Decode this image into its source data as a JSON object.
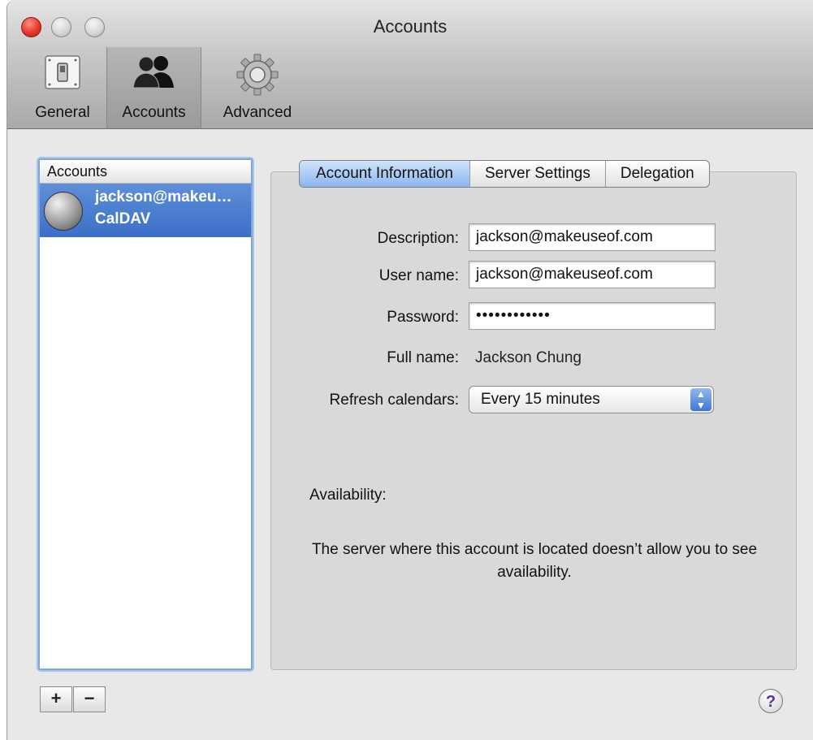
{
  "window": {
    "title": "Accounts"
  },
  "toolbar": {
    "items": [
      {
        "label": "General",
        "icon": "switch-icon",
        "active": false
      },
      {
        "label": "Accounts",
        "icon": "people-icon",
        "active": true
      },
      {
        "label": "Advanced",
        "icon": "gear-icon",
        "active": false
      }
    ]
  },
  "sidebar": {
    "header": "Accounts",
    "accounts": [
      {
        "name": "jackson@makeu…",
        "type": "CalDAV",
        "selected": true
      }
    ],
    "add_label": "+",
    "remove_label": "−"
  },
  "tabs": [
    "Account Information",
    "Server Settings",
    "Delegation"
  ],
  "form": {
    "description_label": "Description:",
    "description_value": "jackson@makeuseof.com",
    "username_label": "User name:",
    "username_value": "jackson@makeuseof.com",
    "password_label": "Password:",
    "password_value": "••••••••••••",
    "fullname_label": "Full name:",
    "fullname_value": "Jackson Chung",
    "refresh_label": "Refresh calendars:",
    "refresh_value": "Every 15 minutes",
    "stepper_glyph": "▲▼"
  },
  "availability": {
    "label": "Availability:",
    "message": "The server where this account is located doesn’t allow you to see availability."
  },
  "help": {
    "label": "?"
  },
  "colors": {
    "selection": "#3c6fc8",
    "active_tab": "#8bb5ee",
    "focus_ring": "#7fa6db"
  }
}
